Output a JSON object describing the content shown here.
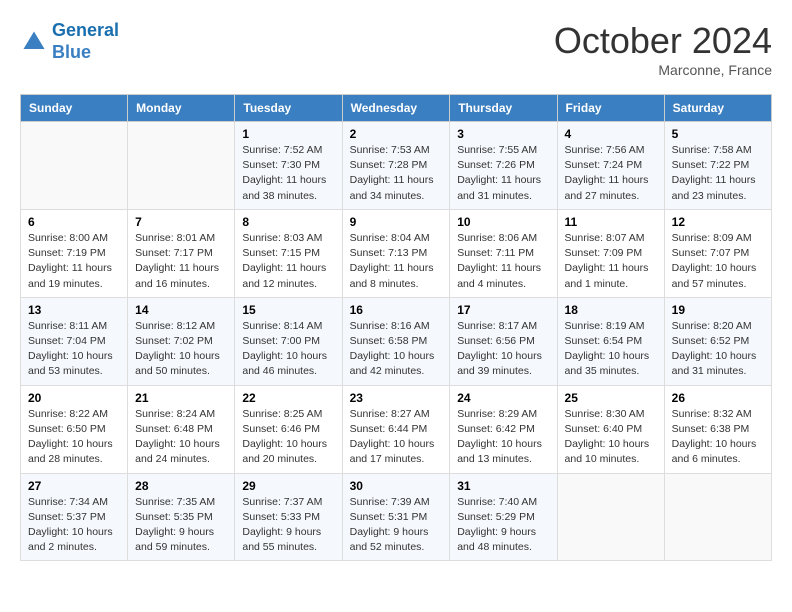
{
  "header": {
    "logo_line1": "General",
    "logo_line2": "Blue",
    "month": "October 2024",
    "location": "Marconne, France"
  },
  "weekdays": [
    "Sunday",
    "Monday",
    "Tuesday",
    "Wednesday",
    "Thursday",
    "Friday",
    "Saturday"
  ],
  "weeks": [
    [
      {
        "day": "",
        "detail": ""
      },
      {
        "day": "",
        "detail": ""
      },
      {
        "day": "1",
        "detail": "Sunrise: 7:52 AM\nSunset: 7:30 PM\nDaylight: 11 hours and 38 minutes."
      },
      {
        "day": "2",
        "detail": "Sunrise: 7:53 AM\nSunset: 7:28 PM\nDaylight: 11 hours and 34 minutes."
      },
      {
        "day": "3",
        "detail": "Sunrise: 7:55 AM\nSunset: 7:26 PM\nDaylight: 11 hours and 31 minutes."
      },
      {
        "day": "4",
        "detail": "Sunrise: 7:56 AM\nSunset: 7:24 PM\nDaylight: 11 hours and 27 minutes."
      },
      {
        "day": "5",
        "detail": "Sunrise: 7:58 AM\nSunset: 7:22 PM\nDaylight: 11 hours and 23 minutes."
      }
    ],
    [
      {
        "day": "6",
        "detail": "Sunrise: 8:00 AM\nSunset: 7:19 PM\nDaylight: 11 hours and 19 minutes."
      },
      {
        "day": "7",
        "detail": "Sunrise: 8:01 AM\nSunset: 7:17 PM\nDaylight: 11 hours and 16 minutes."
      },
      {
        "day": "8",
        "detail": "Sunrise: 8:03 AM\nSunset: 7:15 PM\nDaylight: 11 hours and 12 minutes."
      },
      {
        "day": "9",
        "detail": "Sunrise: 8:04 AM\nSunset: 7:13 PM\nDaylight: 11 hours and 8 minutes."
      },
      {
        "day": "10",
        "detail": "Sunrise: 8:06 AM\nSunset: 7:11 PM\nDaylight: 11 hours and 4 minutes."
      },
      {
        "day": "11",
        "detail": "Sunrise: 8:07 AM\nSunset: 7:09 PM\nDaylight: 11 hours and 1 minute."
      },
      {
        "day": "12",
        "detail": "Sunrise: 8:09 AM\nSunset: 7:07 PM\nDaylight: 10 hours and 57 minutes."
      }
    ],
    [
      {
        "day": "13",
        "detail": "Sunrise: 8:11 AM\nSunset: 7:04 PM\nDaylight: 10 hours and 53 minutes."
      },
      {
        "day": "14",
        "detail": "Sunrise: 8:12 AM\nSunset: 7:02 PM\nDaylight: 10 hours and 50 minutes."
      },
      {
        "day": "15",
        "detail": "Sunrise: 8:14 AM\nSunset: 7:00 PM\nDaylight: 10 hours and 46 minutes."
      },
      {
        "day": "16",
        "detail": "Sunrise: 8:16 AM\nSunset: 6:58 PM\nDaylight: 10 hours and 42 minutes."
      },
      {
        "day": "17",
        "detail": "Sunrise: 8:17 AM\nSunset: 6:56 PM\nDaylight: 10 hours and 39 minutes."
      },
      {
        "day": "18",
        "detail": "Sunrise: 8:19 AM\nSunset: 6:54 PM\nDaylight: 10 hours and 35 minutes."
      },
      {
        "day": "19",
        "detail": "Sunrise: 8:20 AM\nSunset: 6:52 PM\nDaylight: 10 hours and 31 minutes."
      }
    ],
    [
      {
        "day": "20",
        "detail": "Sunrise: 8:22 AM\nSunset: 6:50 PM\nDaylight: 10 hours and 28 minutes."
      },
      {
        "day": "21",
        "detail": "Sunrise: 8:24 AM\nSunset: 6:48 PM\nDaylight: 10 hours and 24 minutes."
      },
      {
        "day": "22",
        "detail": "Sunrise: 8:25 AM\nSunset: 6:46 PM\nDaylight: 10 hours and 20 minutes."
      },
      {
        "day": "23",
        "detail": "Sunrise: 8:27 AM\nSunset: 6:44 PM\nDaylight: 10 hours and 17 minutes."
      },
      {
        "day": "24",
        "detail": "Sunrise: 8:29 AM\nSunset: 6:42 PM\nDaylight: 10 hours and 13 minutes."
      },
      {
        "day": "25",
        "detail": "Sunrise: 8:30 AM\nSunset: 6:40 PM\nDaylight: 10 hours and 10 minutes."
      },
      {
        "day": "26",
        "detail": "Sunrise: 8:32 AM\nSunset: 6:38 PM\nDaylight: 10 hours and 6 minutes."
      }
    ],
    [
      {
        "day": "27",
        "detail": "Sunrise: 7:34 AM\nSunset: 5:37 PM\nDaylight: 10 hours and 2 minutes."
      },
      {
        "day": "28",
        "detail": "Sunrise: 7:35 AM\nSunset: 5:35 PM\nDaylight: 9 hours and 59 minutes."
      },
      {
        "day": "29",
        "detail": "Sunrise: 7:37 AM\nSunset: 5:33 PM\nDaylight: 9 hours and 55 minutes."
      },
      {
        "day": "30",
        "detail": "Sunrise: 7:39 AM\nSunset: 5:31 PM\nDaylight: 9 hours and 52 minutes."
      },
      {
        "day": "31",
        "detail": "Sunrise: 7:40 AM\nSunset: 5:29 PM\nDaylight: 9 hours and 48 minutes."
      },
      {
        "day": "",
        "detail": ""
      },
      {
        "day": "",
        "detail": ""
      }
    ]
  ]
}
